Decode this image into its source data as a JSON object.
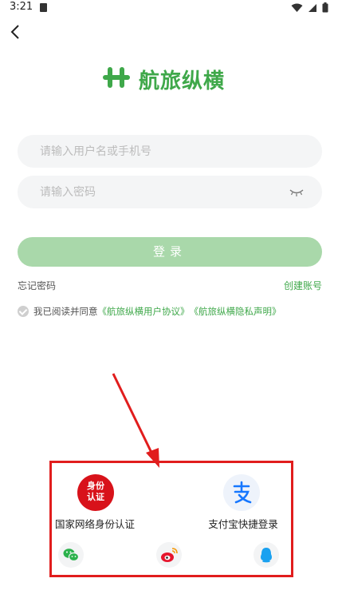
{
  "status_bar": {
    "time": "3:21"
  },
  "logo": {
    "text": "航旅纵横"
  },
  "form": {
    "username_placeholder": "请输入用户名或手机号",
    "password_placeholder": "请输入密码",
    "login_label": "登录"
  },
  "links": {
    "forgot_password": "忘记密码",
    "create_account": "创建账号"
  },
  "agreement": {
    "prefix": "我已阅读并同意",
    "user_agreement": "《航旅纵横用户协议》",
    "privacy_statement": "《航旅纵横隐私声明》"
  },
  "quick_login": {
    "gov_id_badge_line1": "身份",
    "gov_id_badge_line2": "认证",
    "gov_id_label": "国家网络身份认证",
    "alipay_label": "支付宝快捷登录"
  },
  "colors": {
    "brand_green": "#3fa84a",
    "login_button": "#a9d8aa",
    "annotation_red": "#e11d1d"
  },
  "icons": [
    "back-arrow-icon",
    "eye-closed-icon",
    "check-icon",
    "wechat-icon",
    "weibo-icon",
    "qq-icon",
    "alipay-icon",
    "wifi-icon",
    "battery-icon"
  ]
}
